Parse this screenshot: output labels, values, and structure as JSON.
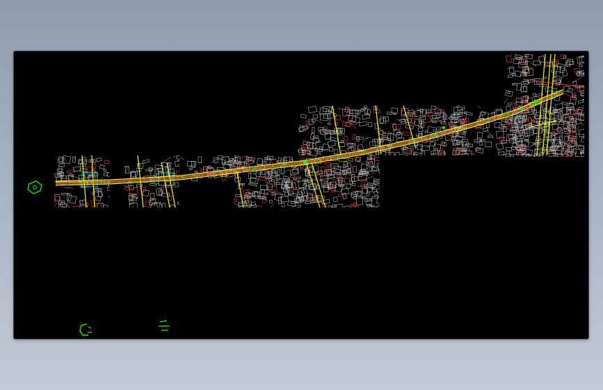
{
  "drawing": {
    "background_color": "#000000",
    "page_gradient": [
      "#8e9cae",
      "#c3cad5"
    ],
    "layer_colors": {
      "buildings": "#b9b9b9",
      "road_edge": "#ffff00",
      "centerline": "#ff3b3b",
      "annotations": "#00ff00",
      "utility": "#ff00ff",
      "route_fill": "#d8a43a",
      "cyan_marks": "#00ffff"
    },
    "symbols": [
      "north-arrow-symbol",
      "scale-mark-symbol",
      "scale-mark-symbol-2"
    ]
  }
}
